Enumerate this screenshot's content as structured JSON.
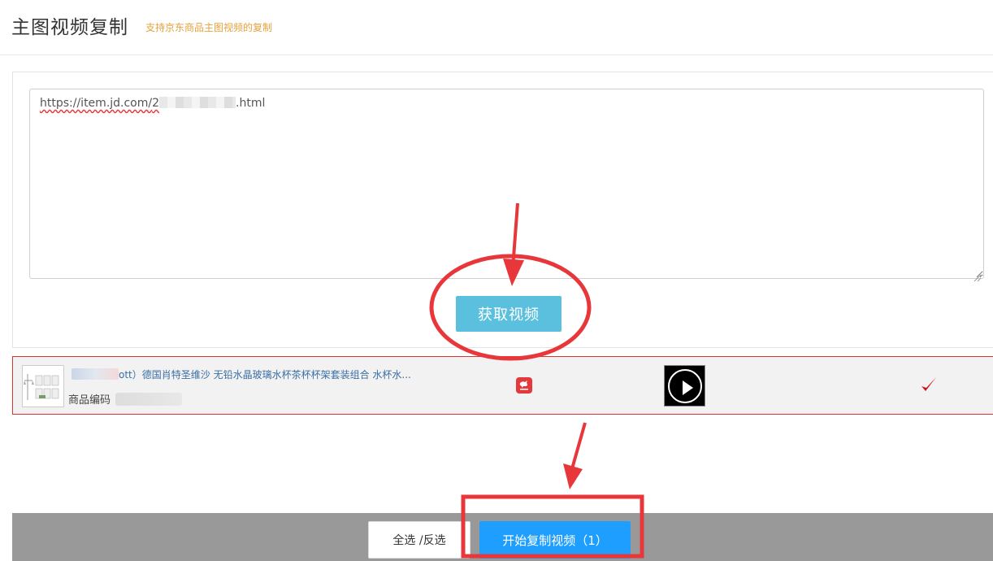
{
  "header": {
    "title": "主图视频复制",
    "subtitle": "支持京东商品主图视频的复制"
  },
  "input_panel": {
    "url_prefix": "https://item.jd.com/",
    "url_partial": "2",
    "url_suffix": ".html",
    "fetch_button_label": "获取视频"
  },
  "result": {
    "title_text": "ott）德国肖特圣维沙 无铅水晶玻璃水杯茶杯杯架套装组合 水杯水...",
    "code_label": "商品编码",
    "source_icon": "jd-logo-icon",
    "video_icon": "play-icon",
    "status_icon": "check-icon"
  },
  "footer": {
    "select_all_label": "全选 /反选",
    "start_copy_label": "开始复制视频（1）"
  },
  "colors": {
    "subtitle": "#e6a23c",
    "fetch_button": "#5bc0de",
    "start_button": "#1e9fff",
    "annotation_red": "#e8373a",
    "row_border": "#d9372e"
  }
}
